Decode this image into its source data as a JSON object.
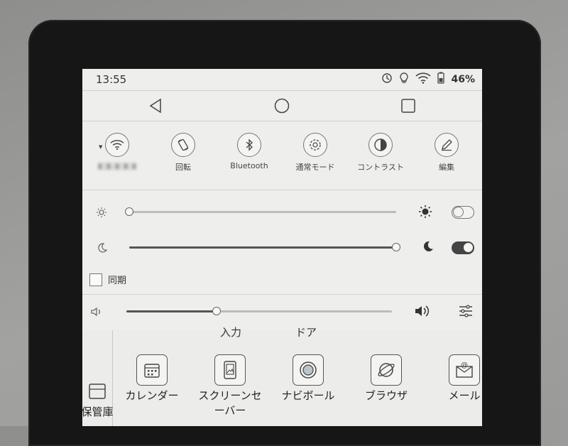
{
  "status_bar": {
    "time": "13:55",
    "battery_percent": "46%",
    "icons": [
      "sync-icon",
      "bulb-icon",
      "wifi-icon",
      "battery-icon"
    ]
  },
  "nav_bar": {
    "icons": [
      "back-icon",
      "home-icon",
      "recents-icon"
    ]
  },
  "quick_settings": [
    {
      "name": "wifi",
      "label": "",
      "icon": "wifi-icon"
    },
    {
      "name": "rotation",
      "label": "回転",
      "icon": "rotate-icon"
    },
    {
      "name": "bluetooth",
      "label": "Bluetooth",
      "icon": "bluetooth-icon"
    },
    {
      "name": "normal-mode",
      "label": "通常モード",
      "icon": "refresh-mode-icon"
    },
    {
      "name": "contrast",
      "label": "コントラスト",
      "icon": "contrast-icon"
    },
    {
      "name": "edit",
      "label": "編集",
      "icon": "pencil-icon"
    }
  ],
  "sliders": {
    "front_light": {
      "level": 0.0,
      "toggle_on": false,
      "icons": [
        "sun-small-icon",
        "sun-large-icon"
      ]
    },
    "warm_light": {
      "level": 1.0,
      "toggle_on": true,
      "icons": [
        "moon-small-icon",
        "moon-large-icon"
      ]
    },
    "sync_checkbox": {
      "label": "同期",
      "checked": false
    },
    "volume": {
      "level": 0.34,
      "icons": [
        "volume-low-icon",
        "volume-high-icon",
        "equalizer-icon"
      ]
    }
  },
  "bottom": {
    "cut_labels": [
      "入力",
      "ドア"
    ],
    "storage_label": "保管庫",
    "apps": [
      {
        "label": "カレンダー",
        "icon": "calendar-icon"
      },
      {
        "label": "スクリーンセ\nーバー",
        "icon": "screensaver-icon"
      },
      {
        "label": "ナビボール",
        "icon": "navball-icon"
      },
      {
        "label": "ブラウザ",
        "icon": "browser-icon"
      },
      {
        "label": "メール",
        "icon": "mail-icon"
      }
    ]
  },
  "colors": {
    "screen_bg": "#eeefec",
    "bezel": "#161616",
    "accent_dark": "#444444"
  }
}
